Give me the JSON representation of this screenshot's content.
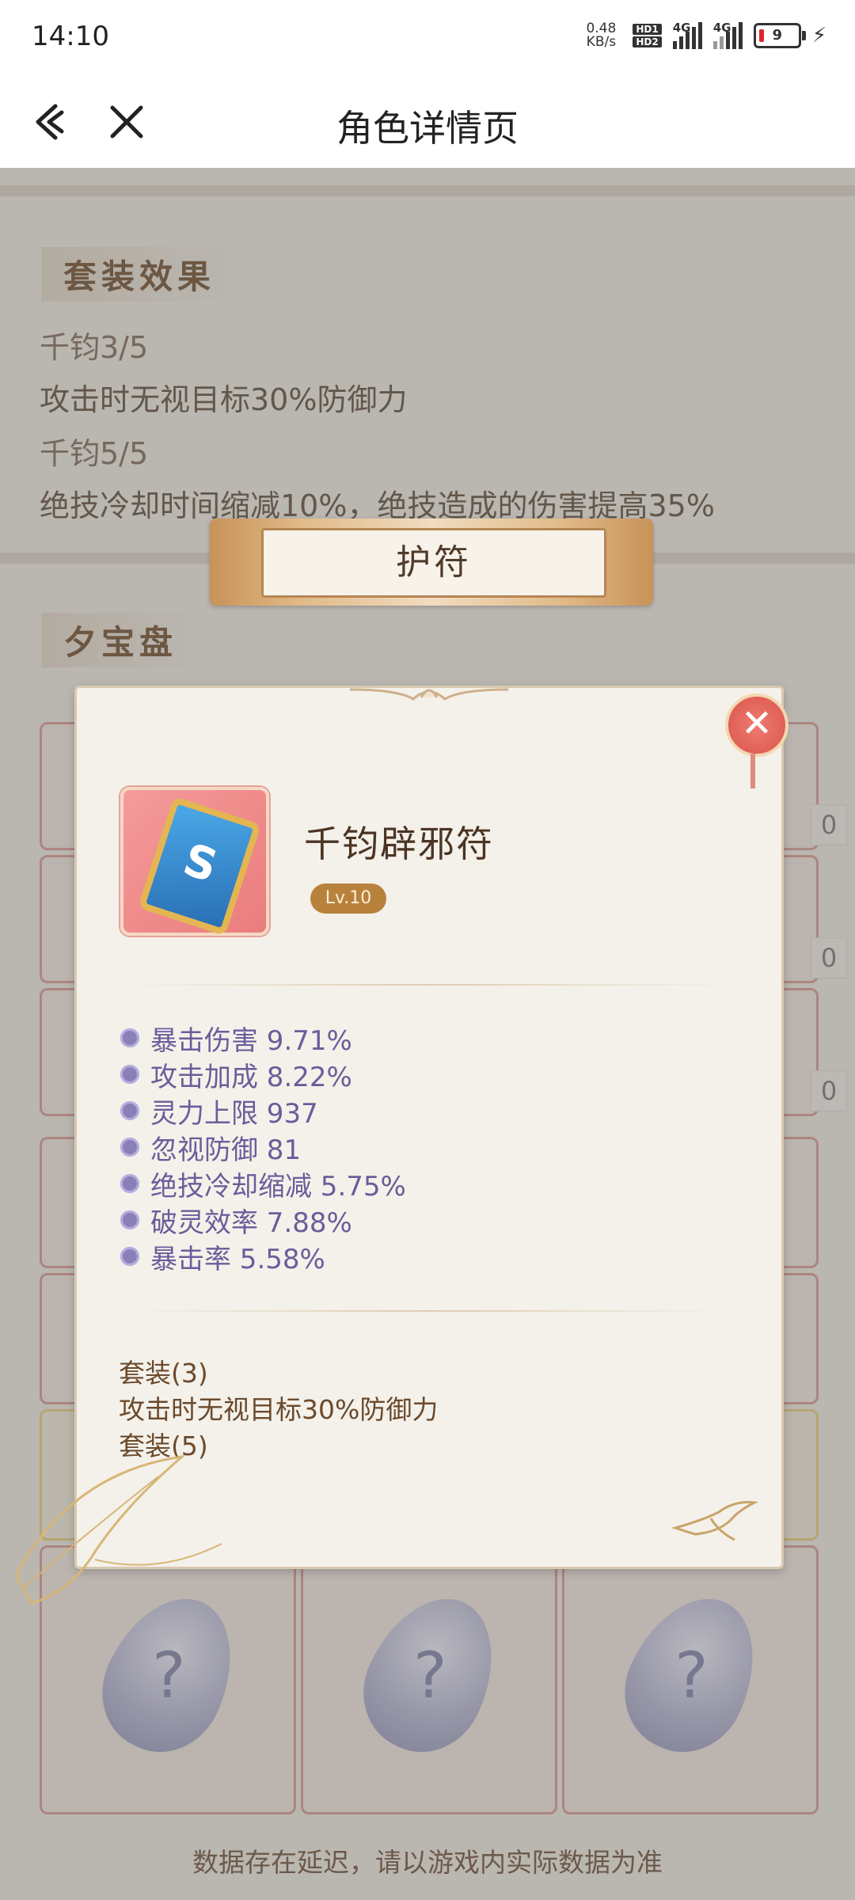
{
  "status_bar": {
    "time": "14:10",
    "net_speed_value": "0.48",
    "net_speed_unit": "KB/s",
    "hd1": "HD1",
    "hd2": "HD2",
    "signal1_label": "4G",
    "signal2_label": "4G",
    "battery_level": "9"
  },
  "header": {
    "title": "角色详情页"
  },
  "background": {
    "set_effect_heading": "套装效果",
    "set_lines": [
      "千钧3/5",
      "攻击时无视目标30%防御力",
      "千钧5/5",
      "绝技冷却时间缩减10%，绝技造成的伤害提高35%"
    ],
    "treasure_heading": "夕宝盘",
    "side_values": [
      "0",
      "0",
      "0"
    ],
    "stone_glyph": "?",
    "footer_note": "数据存在延迟，请以游戏内实际数据为准"
  },
  "dialog": {
    "banner_title": "护符",
    "item": {
      "name": "千钧辟邪符",
      "level": "Lv.10",
      "icon": "talisman-icon",
      "icon_glyph": "S"
    },
    "attributes": [
      "暴击伤害 9.71%",
      "攻击加成 8.22%",
      "灵力上限 937",
      "忽视防御 81",
      "绝技冷却缩减 5.75%",
      "破灵效率 7.88%",
      "暴击率 5.58%"
    ],
    "set_bonus": {
      "set3_label": "套装(3)",
      "set3_effect": "攻击时无视目标30%防御力",
      "set5_label": "套装(5)"
    }
  },
  "colors": {
    "accent_brown": "#6b4a2c",
    "attr_purple": "#6a5d9b",
    "slot_red": "#d99a97",
    "close_red": "#d8534a"
  }
}
